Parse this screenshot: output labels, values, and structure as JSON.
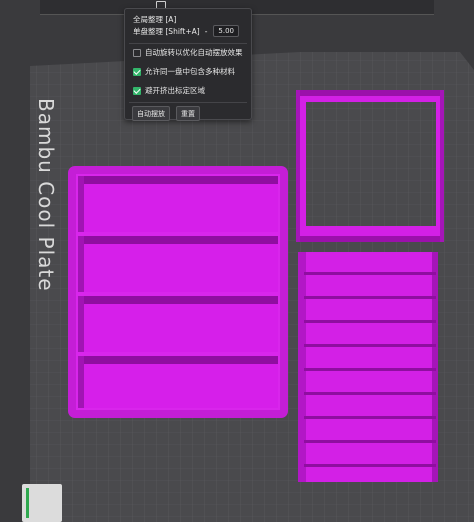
{
  "plate": {
    "label": "Bambu Cool Plate"
  },
  "arrange_popup": {
    "option_title_1": "全局整理 [A]",
    "option_title_2": "单盘整理 [Shift+A]",
    "spacing_value": "5.00",
    "checkboxes": [
      {
        "label": "自动旋转以优化自动摆放效果",
        "checked": false
      },
      {
        "label": "允许同一盘中包含多种材料",
        "checked": true
      },
      {
        "label": "避开挤出标定区域",
        "checked": true
      }
    ],
    "buttons": {
      "arrange": "自动摆放",
      "reset": "重置"
    }
  },
  "colors": {
    "background": "#3a3a3d",
    "plate": "#4a4a4d",
    "grid": "#5a5a5e",
    "model": "#d320e6",
    "model_shade": "#9b10ab",
    "accent": "#33b56a"
  }
}
